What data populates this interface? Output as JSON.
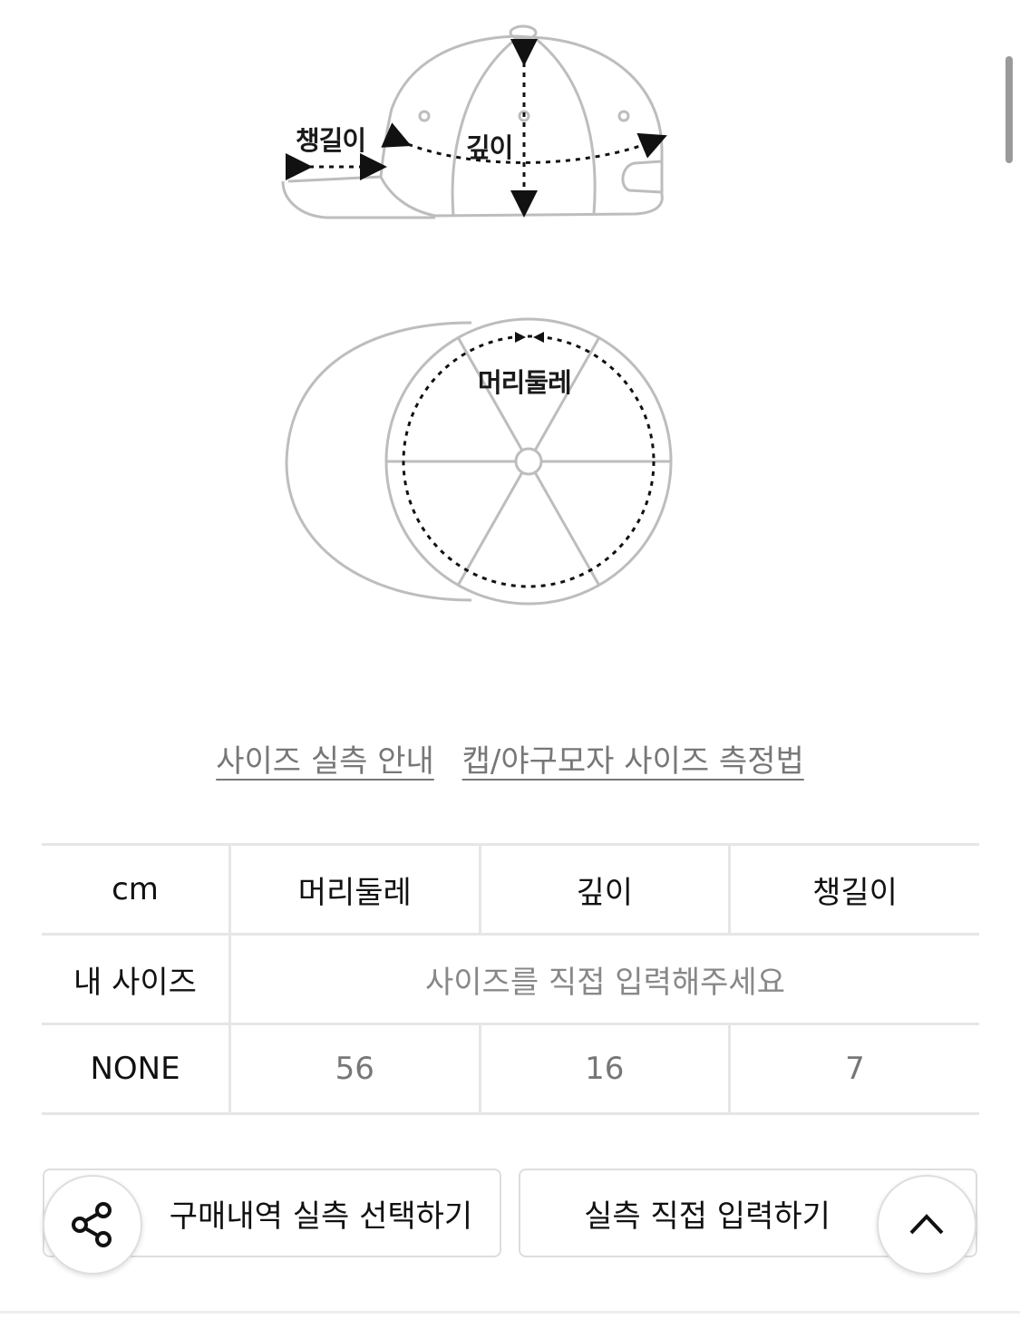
{
  "diagram": {
    "side_labels": {
      "brim": "챙길이",
      "depth": "깊이"
    },
    "top_labels": {
      "circumference": "머리둘레"
    }
  },
  "links": {
    "guide": "사이즈 실측 안내",
    "method": "캡/야구모자 사이즈 측정법"
  },
  "table": {
    "headers": [
      "cm",
      "머리둘레",
      "깊이",
      "챙길이"
    ],
    "my_size": {
      "label": "내 사이즈",
      "placeholder": "사이즈를 직접 입력해주세요"
    },
    "rows": [
      {
        "label": "NONE",
        "values": [
          "56",
          "16",
          "7"
        ]
      }
    ]
  },
  "buttons": {
    "purchase_select": "구매내역 실측 선택하기",
    "direct_input": "실측 직접 입력하기"
  },
  "icons": {
    "share": "share-icon",
    "scroll_top": "chevron-up-icon"
  },
  "colors": {
    "link": "#777777",
    "border": "#e6e6e6",
    "value_text": "#777777"
  }
}
